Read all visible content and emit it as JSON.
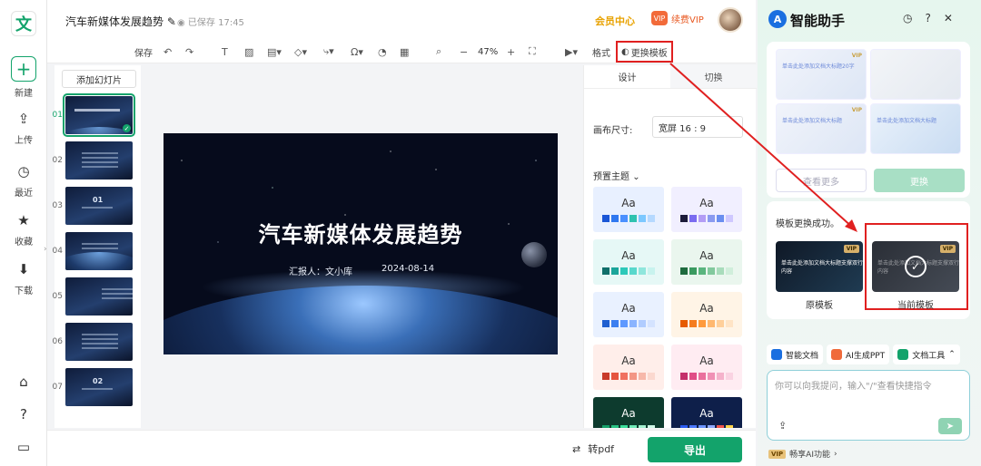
{
  "app": {
    "logo_char": "文",
    "accent": "#13a36b"
  },
  "rail": {
    "items": [
      {
        "label": "新建",
        "icon": "plus-icon"
      },
      {
        "label": "上传",
        "icon": "upload-icon"
      },
      {
        "label": "最近",
        "icon": "clock-icon"
      },
      {
        "label": "收藏",
        "icon": "star-icon"
      },
      {
        "label": "下载",
        "icon": "download-icon"
      }
    ]
  },
  "header": {
    "doc_title": "汽车新媒体发展趋势",
    "saved_status": "已保存 17:45",
    "member_center": "会员中心",
    "renew_vip": "续费VIP",
    "vip_badge": "VIP"
  },
  "toolbar": {
    "save": "保存",
    "zoom": "47%",
    "format": "格式",
    "change_template": "更换模板"
  },
  "slides_panel": {
    "add_slide": "添加幻灯片",
    "thumbs": [
      {
        "num": "01",
        "title": "汽车新媒体发展趋势"
      },
      {
        "num": "02",
        "title": "目录"
      },
      {
        "num": "03",
        "title": "01"
      },
      {
        "num": "04",
        "title": ""
      },
      {
        "num": "05",
        "title": ""
      },
      {
        "num": "06",
        "title": ""
      },
      {
        "num": "07",
        "title": "02"
      }
    ]
  },
  "slide": {
    "title": "汽车新媒体发展趋势",
    "reporter": "汇报人：文小库",
    "date": "2024-08-14"
  },
  "design_panel": {
    "tab_design": "设计",
    "tab_switch": "切换",
    "canvas_size_label": "画布尺寸:",
    "canvas_size_value": "宽屏 16 : 9",
    "preset_theme": "预置主题",
    "themes": [
      {
        "aa": "Aa",
        "bg": "#e8f0ff",
        "sw": [
          "#1a56d6",
          "#2f78f0",
          "#4a90ff",
          "#2ec2b0",
          "#7cc8ff",
          "#b5d9ff"
        ]
      },
      {
        "aa": "Aa",
        "bg": "#f1efff",
        "sw": [
          "#1b1b3a",
          "#7a6bf0",
          "#b39cf5",
          "#8a9af0",
          "#6a8ef0",
          "#cfc8ff"
        ]
      },
      {
        "aa": "Aa",
        "bg": "#e6f8f6",
        "sw": [
          "#0f6f6a",
          "#1aa59a",
          "#2cc9b9",
          "#58d8cc",
          "#8fe6dc",
          "#c8f3ee"
        ]
      },
      {
        "aa": "Aa",
        "bg": "#eaf6ee",
        "sw": [
          "#1e6b3e",
          "#3a9a60",
          "#5ab57e",
          "#82c99d",
          "#a8dcbb",
          "#d0eedb"
        ]
      },
      {
        "aa": "Aa",
        "bg": "#e9f1ff",
        "sw": [
          "#1f5fd0",
          "#3c7ff0",
          "#5e99ff",
          "#8ab4ff",
          "#b0ccff",
          "#d4e3ff"
        ]
      },
      {
        "aa": "Aa",
        "bg": "#fff4e6",
        "sw": [
          "#e65a00",
          "#f57c1f",
          "#ff9a3c",
          "#ffb870",
          "#ffcf9a",
          "#ffe4c6"
        ]
      },
      {
        "aa": "Aa",
        "bg": "#ffeeea",
        "sw": [
          "#c83a2a",
          "#e5543f",
          "#f07060",
          "#f39685",
          "#f7b8aa",
          "#fbd8cf"
        ]
      },
      {
        "aa": "Aa",
        "bg": "#ffecf2",
        "sw": [
          "#c4306b",
          "#e04d86",
          "#ea6f9d",
          "#f090b5",
          "#f5b2cb",
          "#fad3e2"
        ]
      },
      {
        "aa": "Aa",
        "bg": "#0d3b2e",
        "dark": true,
        "sw": [
          "#16a06a",
          "#28c283",
          "#3adf9b",
          "#6fe9b7",
          "#a3f1d1",
          "#d0f8e8"
        ]
      },
      {
        "aa": "Aa",
        "bg": "#0e1f4a",
        "dark": true,
        "sw": [
          "#2a5af0",
          "#4a77ff",
          "#6a92ff",
          "#8ea9ff",
          "#f0544b",
          "#ffd34a"
        ]
      }
    ]
  },
  "bottom": {
    "to_pdf": "转pdf",
    "export": "导出"
  },
  "assistant": {
    "title": "智能助手",
    "tpl_text": "单击此处添加文档大标题20字",
    "tpl_text2": "单击此处添加文档大标题",
    "vip_mark": "VIP",
    "view_more": "查看更多",
    "replace": "更换",
    "success_msg": "模板更换成功。",
    "opt_text": "单击此处添加文档大标题支撑双行内容",
    "original": "原模板",
    "current": "当前模板",
    "chips": [
      {
        "label": "智能文档",
        "color": "#1a6fe0"
      },
      {
        "label": "AI生成PPT",
        "color": "#f06a3a"
      },
      {
        "label": "文档工具",
        "color": "#13a36b"
      }
    ],
    "input_placeholder": "你可以向我提问，输入\"/\"查看快捷指令",
    "vip_ai": "畅享AI功能",
    "vip_ai_badge": "VIP"
  }
}
